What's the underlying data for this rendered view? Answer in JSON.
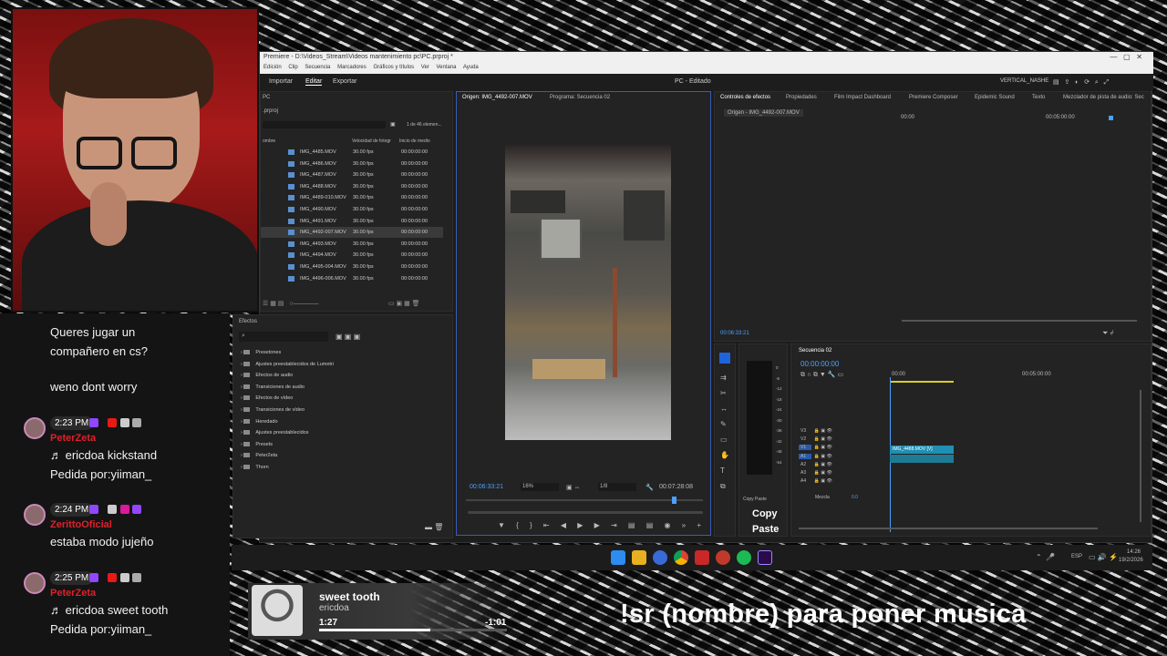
{
  "chat": {
    "msg1a": "Queres jugar un",
    "msg1b": "compañero en cs?",
    "msg2": "weno dont worry",
    "e1": {
      "time": "2:23 PM",
      "user": "PeterZeta",
      "text1": "♬ ericdoa kickstand",
      "text2": "Pedida por:yiiman_"
    },
    "e2": {
      "time": "2:24 PM",
      "user": "ZerittoOficial",
      "text1": "estaba modo jujeño"
    },
    "e3": {
      "time": "2:25 PM",
      "user": "PeterZeta",
      "text1": "♬ ericdoa sweet tooth",
      "text2": "Pedida por:yiiman_"
    }
  },
  "premiere": {
    "title": "Premiere - D:\\Videos_Stream\\Videos mantenimiento pc\\PC.prproj *",
    "menu": [
      "Edición",
      "Clip",
      "Secuencia",
      "Marcadores",
      "Gráficos y títulos",
      "Ver",
      "Ventana",
      "Ayuda"
    ],
    "workspace_tabs": [
      "Importar",
      "Editar",
      "Exportar"
    ],
    "doc_title": "PC - Editado",
    "workspace_name": "VERTICAL_NASHE",
    "project": {
      "tab": "PC",
      "file": ".prproj",
      "count": "1 de 46 elemen...",
      "col_name": "ombre",
      "col_fps": "Velocidad de fotogr",
      "col_start": "Inicio de medio",
      "rows": [
        {
          "name": "IMG_4485.MOV",
          "fps": "30.00 fps",
          "start": "00:00:00:00"
        },
        {
          "name": "IMG_4486.MOV",
          "fps": "30.00 fps",
          "start": "00:00:00:00"
        },
        {
          "name": "IMG_4487.MOV",
          "fps": "30.00 fps",
          "start": "00:00:00:00"
        },
        {
          "name": "IMG_4488.MOV",
          "fps": "30.00 fps",
          "start": "00:00:00:00"
        },
        {
          "name": "IMG_4489-010.MOV",
          "fps": "30.00 fps",
          "start": "00:00:00:00"
        },
        {
          "name": "IMG_4490.MOV",
          "fps": "30.00 fps",
          "start": "00:00:00:00"
        },
        {
          "name": "IMG_4491.MOV",
          "fps": "30.00 fps",
          "start": "00:00:00:00"
        },
        {
          "name": "IMG_4492-007.MOV",
          "fps": "30.00 fps",
          "start": "00:00:00:00"
        },
        {
          "name": "IMG_4493.MOV",
          "fps": "30.00 fps",
          "start": "00:00:00:00"
        },
        {
          "name": "IMG_4494.MOV",
          "fps": "30.00 fps",
          "start": "00:00:00:00"
        },
        {
          "name": "IMG_4495-004.MOV",
          "fps": "30.00 fps",
          "start": "00:00:00:00"
        },
        {
          "name": "IMG_4496-006.MOV",
          "fps": "30.00 fps",
          "start": "00:00:00:00"
        }
      ]
    },
    "effects": {
      "tab": "Efectos",
      "items": [
        "Presetones",
        "Ajustes preestablecidos de Lumetri",
        "Efectos de audio",
        "Transiciones de audio",
        "Efectos de vídeo",
        "Transiciones de vídeo",
        "Heredado",
        "Ajustes preestablecidos",
        "Presets",
        "Peter2eta",
        "Thorn"
      ]
    },
    "source": {
      "tab1": "Origen: IMG_4492-007.MOV",
      "tab2": "Programa: Secuencia 02",
      "timecode": "00:06:33:21",
      "zoom": "16%",
      "res": "1/8",
      "duration": "00:07:28:08"
    },
    "fx_controls": {
      "tabs": [
        "Controles de efectos",
        "Propiedades",
        "Film Impact Dashboard",
        "Premiere Composer",
        "Epidemic Sound",
        "Texto",
        "Mezclador de pista de audio: Sec"
      ],
      "clip": "Origen - IMG_4492-007.MOV",
      "t0": "00:00",
      "t1": "00:05:00:00",
      "bottom_time": "00:06:33:21"
    },
    "copy_paste": {
      "tab": "Copy Paste",
      "copy": "Copy",
      "paste": "Paste"
    },
    "timeline": {
      "tab": "Secuencia 02",
      "timecode": "00:00:00:00",
      "t0": "00:00",
      "t1": "00:05:00:00",
      "clip": "IMG_4488.MOV [V]",
      "tracks": [
        "V3",
        "V2",
        "V1",
        "A1",
        "A2",
        "A3",
        "A4"
      ],
      "mix": "Mezcla",
      "mix_val": "0.0"
    }
  },
  "taskbar": {
    "lang": "ESP",
    "time": "14:26",
    "date": "19/2/2026"
  },
  "music": {
    "title": "sweet tooth",
    "artist": "ericdoa",
    "elapsed": "1:27",
    "remaining": "-1:01",
    "progress": 0.59
  },
  "command": "!sr (nombre) para poner musica"
}
